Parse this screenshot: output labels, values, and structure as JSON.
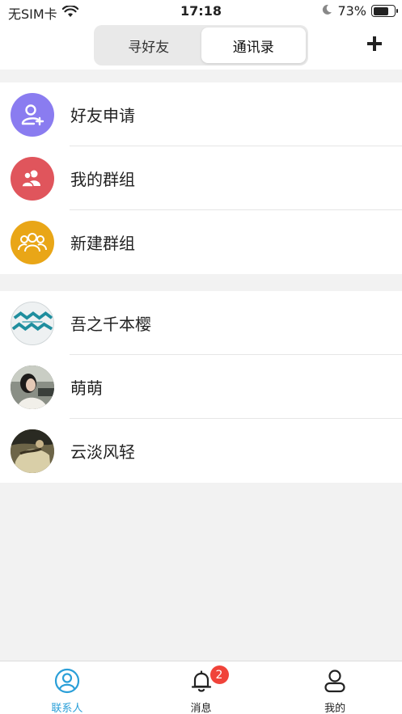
{
  "status_bar": {
    "carrier": "无SIM卡",
    "time": "17:18",
    "battery_percent": "73%",
    "battery_level": 0.73
  },
  "header": {
    "tabs": [
      {
        "label": "寻好友",
        "active": false
      },
      {
        "label": "通讯录",
        "active": true
      }
    ],
    "add_icon": "plus-icon"
  },
  "functions": [
    {
      "label": "好友申请",
      "icon": "add-user-icon",
      "color": "#8a7cf0"
    },
    {
      "label": "我的群组",
      "icon": "group-icon",
      "color": "#e0555c"
    },
    {
      "label": "新建群组",
      "icon": "new-group-icon",
      "color": "#e9a617"
    }
  ],
  "contacts": [
    {
      "name": "吾之千本樱",
      "avatar": "avatar-wave"
    },
    {
      "name": "萌萌",
      "avatar": "avatar-photo-1"
    },
    {
      "name": "云淡风轻",
      "avatar": "avatar-photo-2"
    }
  ],
  "tabbar": {
    "items": [
      {
        "label": "联系人",
        "icon": "contacts-icon",
        "active": true
      },
      {
        "label": "消息",
        "icon": "bell-icon",
        "active": false,
        "badge": "2"
      },
      {
        "label": "我的",
        "icon": "profile-icon",
        "active": false
      }
    ]
  },
  "colors": {
    "accent": "#2a9fd8",
    "badge": "#f0433a",
    "background": "#f2f2f2"
  }
}
